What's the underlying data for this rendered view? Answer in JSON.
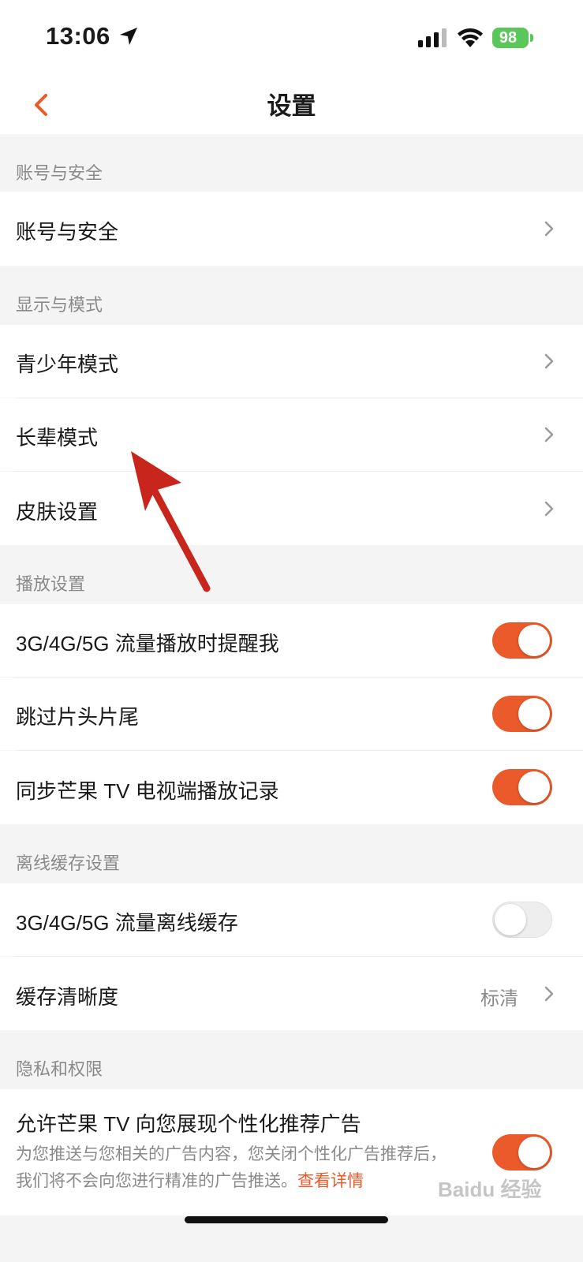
{
  "status_bar": {
    "time": "13:06",
    "battery": "98"
  },
  "nav": {
    "title": "设置"
  },
  "sections": {
    "account": {
      "header": "账号与安全",
      "row_label": "账号与安全"
    },
    "display": {
      "header": "显示与模式",
      "teen_mode": "青少年模式",
      "elder_mode": "长辈模式",
      "skin": "皮肤设置"
    },
    "playback": {
      "header": "播放设置",
      "cellular_remind": {
        "label": "3G/4G/5G 流量播放时提醒我",
        "on": true
      },
      "skip_intro": {
        "label": "跳过片头片尾",
        "on": true
      },
      "sync_tv": {
        "label": "同步芒果 TV 电视端播放记录",
        "on": true
      }
    },
    "offline": {
      "header": "离线缓存设置",
      "cellular_cache": {
        "label": "3G/4G/5G 流量离线缓存",
        "on": false
      },
      "cache_quality": {
        "label": "缓存清晰度",
        "value": "标清"
      }
    },
    "privacy": {
      "header": "隐私和权限",
      "ads": {
        "label": "允许芒果 TV 向您展现个性化推荐广告",
        "desc": "为您推送与您相关的广告内容，您关闭个性化广告推荐后，我们将不会向您进行精准的广告推送。",
        "link": "查看详情",
        "on": true
      }
    }
  },
  "watermark": "Baidu 经验",
  "colors": {
    "accent": "#ea5a2b",
    "arrow": "#c8261d",
    "battery": "#5bc659"
  }
}
